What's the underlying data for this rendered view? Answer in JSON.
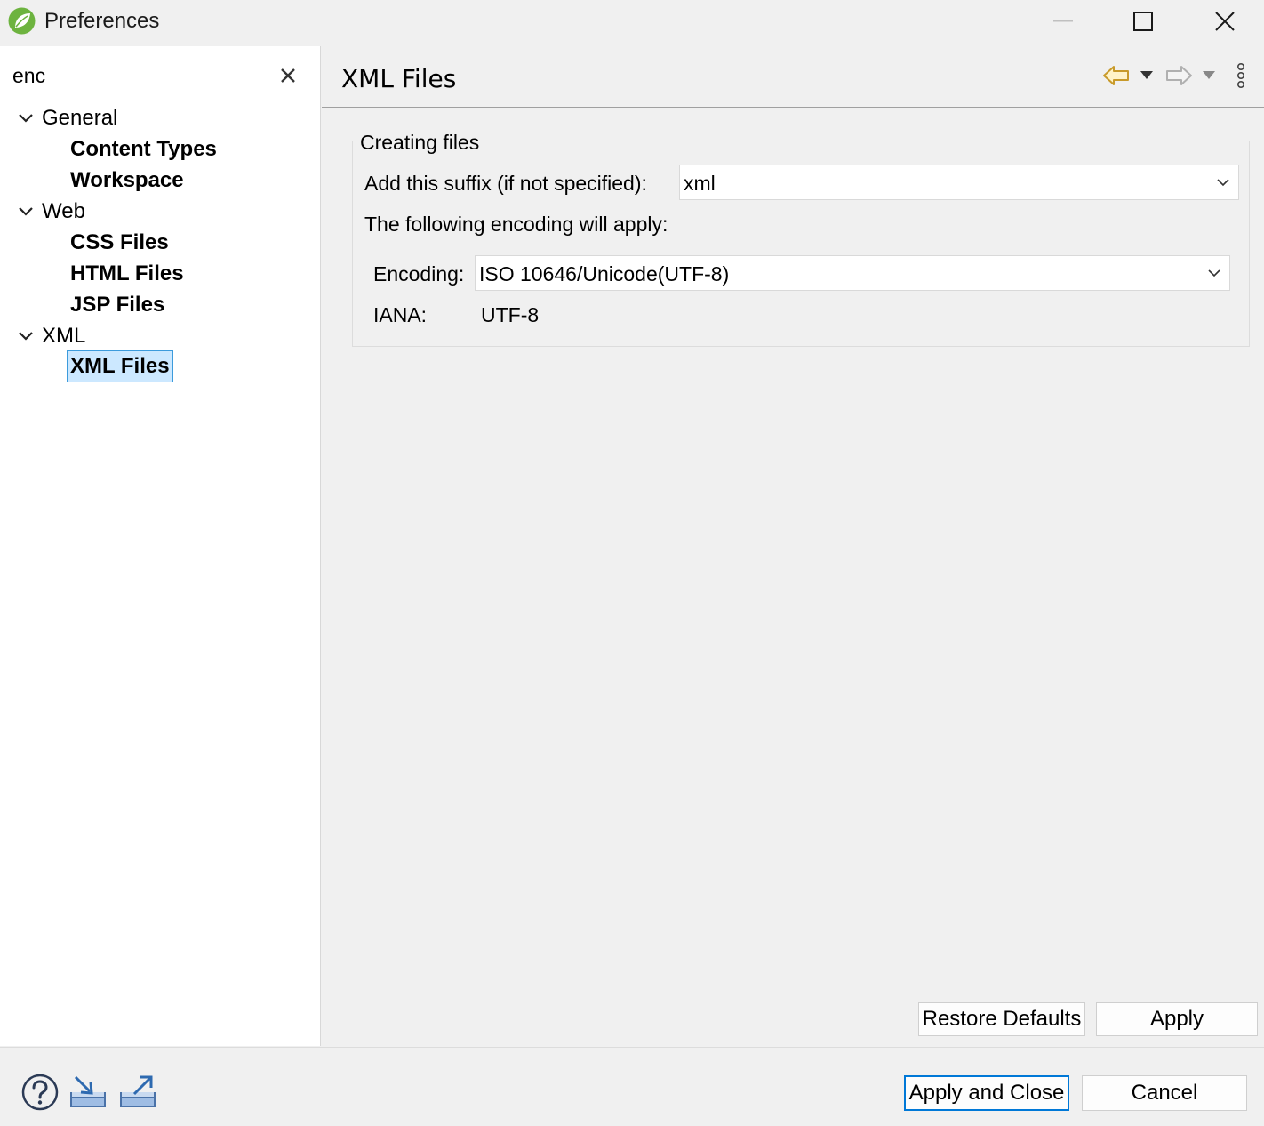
{
  "window": {
    "title": "Preferences",
    "icon": "spring-leaf-icon"
  },
  "filter": {
    "value": "enc"
  },
  "tree": {
    "general": {
      "label": "General",
      "items": [
        "Content Types",
        "Workspace"
      ]
    },
    "web": {
      "label": "Web",
      "items": [
        "CSS Files",
        "HTML Files",
        "JSP Files"
      ]
    },
    "xml": {
      "label": "XML",
      "items": [
        "XML Files"
      ]
    },
    "selected": "XML Files"
  },
  "page": {
    "title": "XML Files",
    "group_title": "Creating files",
    "suffix_label": "Add this suffix (if not specified):",
    "suffix_value": "xml",
    "encoding_intro": "The following encoding will apply:",
    "encoding_label": "Encoding:",
    "encoding_value": "ISO 10646/Unicode(UTF-8)",
    "iana_label": "IANA:",
    "iana_value": "UTF-8"
  },
  "buttons": {
    "restore_defaults": "Restore Defaults",
    "apply": "Apply",
    "apply_and_close": "Apply and Close",
    "cancel": "Cancel"
  },
  "colors": {
    "selection_bg": "#cce8ff",
    "selection_border": "#3c9bdc",
    "default_button_border": "#0078d7",
    "back_arrow": "#c89a2a"
  }
}
